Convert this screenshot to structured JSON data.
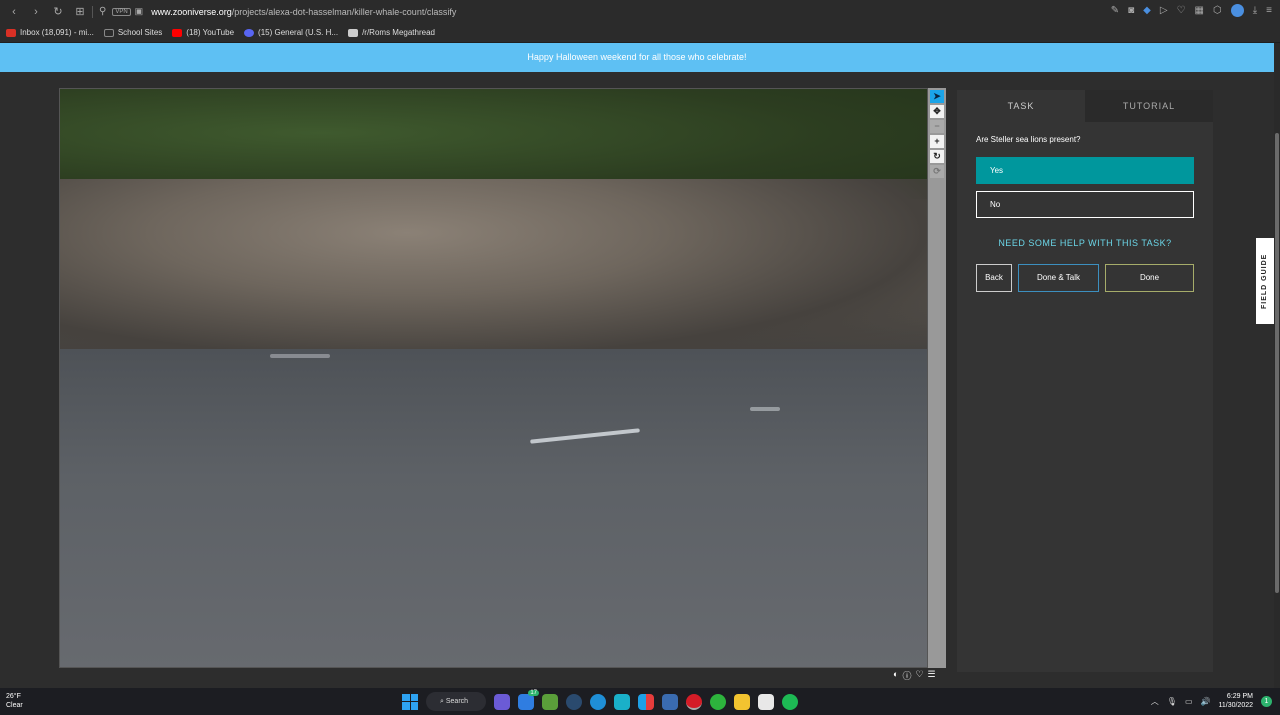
{
  "browser": {
    "url_domain": "www.zooniverse.org",
    "url_path": "/projects/alexa-dot-hasselman/killer-whale-count/classify",
    "vpn_label": "VPN"
  },
  "bookmarks": [
    {
      "label": "Inbox (18,091) - mi...",
      "icon": "gmail-icon",
      "color": "#d93025"
    },
    {
      "label": "School Sites",
      "icon": "folder-icon",
      "color": "#888888"
    },
    {
      "label": "(18) YouTube",
      "icon": "youtube-icon",
      "color": "#ff0000"
    },
    {
      "label": "(15) General (U.S. H...",
      "icon": "discord-icon",
      "color": "#5865f2"
    },
    {
      "label": "/r/Roms Megathread",
      "icon": "page-icon",
      "color": "#cccccc"
    }
  ],
  "banner": {
    "text": "Happy Halloween weekend for all those who celebrate!"
  },
  "toolbar": {
    "tools": [
      {
        "name": "pointer-tool",
        "glyph": "➤",
        "state": "active"
      },
      {
        "name": "pan-tool",
        "glyph": "✥",
        "state": "normal"
      },
      {
        "name": "zoom-out-tool",
        "glyph": "−",
        "state": "disabled"
      },
      {
        "name": "zoom-in-tool",
        "glyph": "+",
        "state": "normal"
      },
      {
        "name": "rotate-tool",
        "glyph": "↻",
        "state": "normal"
      },
      {
        "name": "reset-tool",
        "glyph": "⟳",
        "state": "disabled"
      }
    ]
  },
  "task": {
    "tabs": [
      "TASK",
      "TUTORIAL"
    ],
    "question": "Are Steller sea lions present?",
    "answers": [
      "Yes",
      "No"
    ],
    "selected": "Yes",
    "help": "NEED SOME HELP WITH THIS TASK?",
    "buttons": {
      "back": "Back",
      "done_talk": "Done & Talk",
      "done": "Done"
    }
  },
  "field_guide": "FIELD GUIDE",
  "taskbar": {
    "temperature": "26°F",
    "condition": "Clear",
    "search": "Search",
    "time": "6:29 PM",
    "date": "11/30/2022",
    "notifications": "1",
    "app_badge": "17"
  }
}
